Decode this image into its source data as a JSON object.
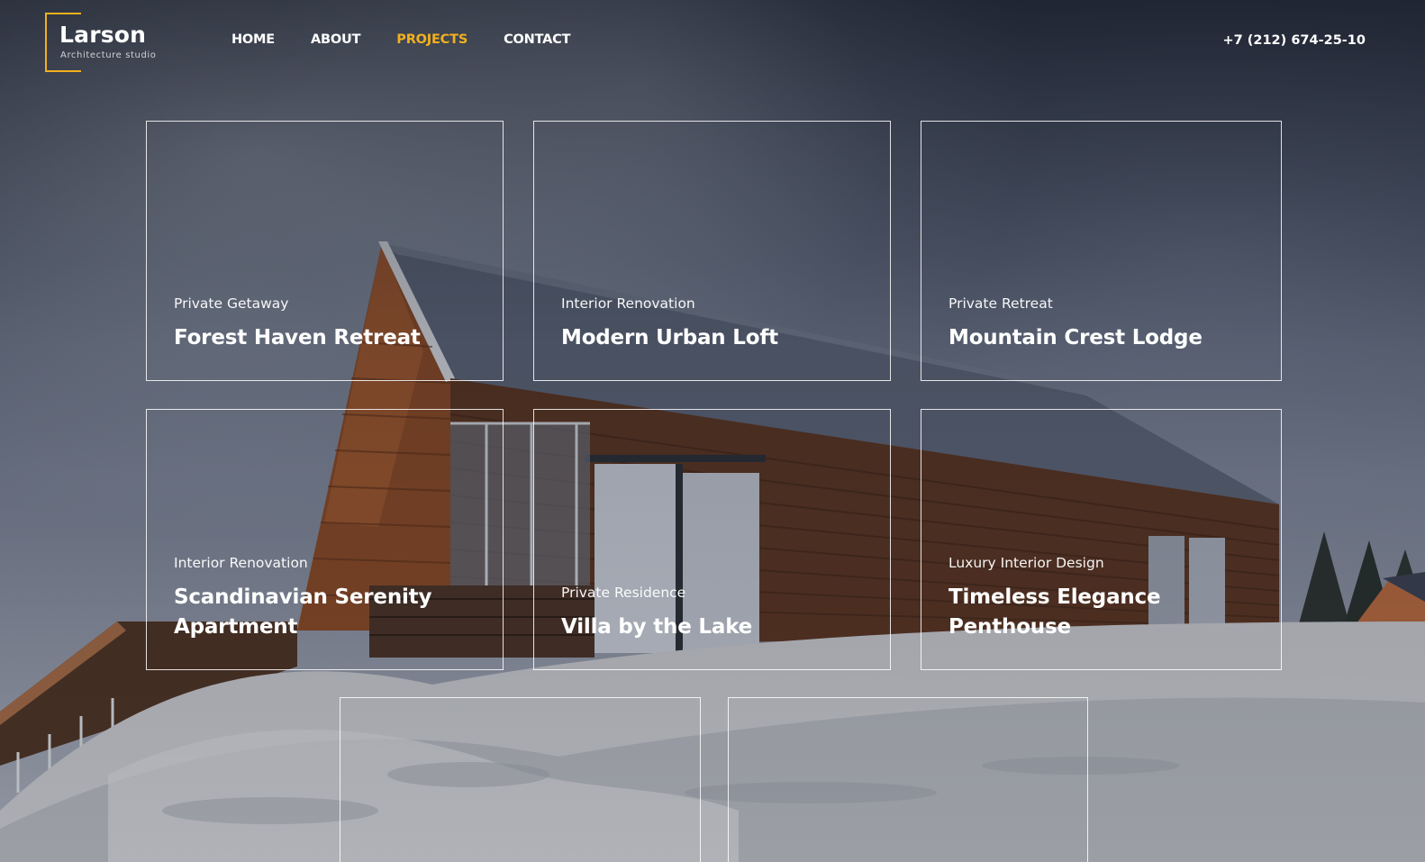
{
  "brand": {
    "name": "Larson",
    "tagline": "Architecture studio",
    "accent_color": "#f2b01e"
  },
  "nav": {
    "items": [
      {
        "label": "HOME",
        "active": false
      },
      {
        "label": "ABOUT",
        "active": false
      },
      {
        "label": "PROJECTS",
        "active": true
      },
      {
        "label": "CONTACT",
        "active": false
      }
    ]
  },
  "contact": {
    "phone": "+7 (212) 674-25-10"
  },
  "projects": [
    {
      "category": "Private Getaway",
      "title": "Forest Haven Retreat"
    },
    {
      "category": "Interior Renovation",
      "title": "Modern Urban Loft"
    },
    {
      "category": "Private Retreat",
      "title": "Mountain Crest Lodge"
    },
    {
      "category": "Interior Renovation",
      "title": "Scandinavian Serenity Apartment"
    },
    {
      "category": "Private Residence",
      "title": "Villa by the Lake"
    },
    {
      "category": "Luxury Interior Design",
      "title": "Timeless Elegance Penthouse"
    },
    {
      "category": "",
      "title": ""
    },
    {
      "category": "",
      "title": ""
    }
  ]
}
